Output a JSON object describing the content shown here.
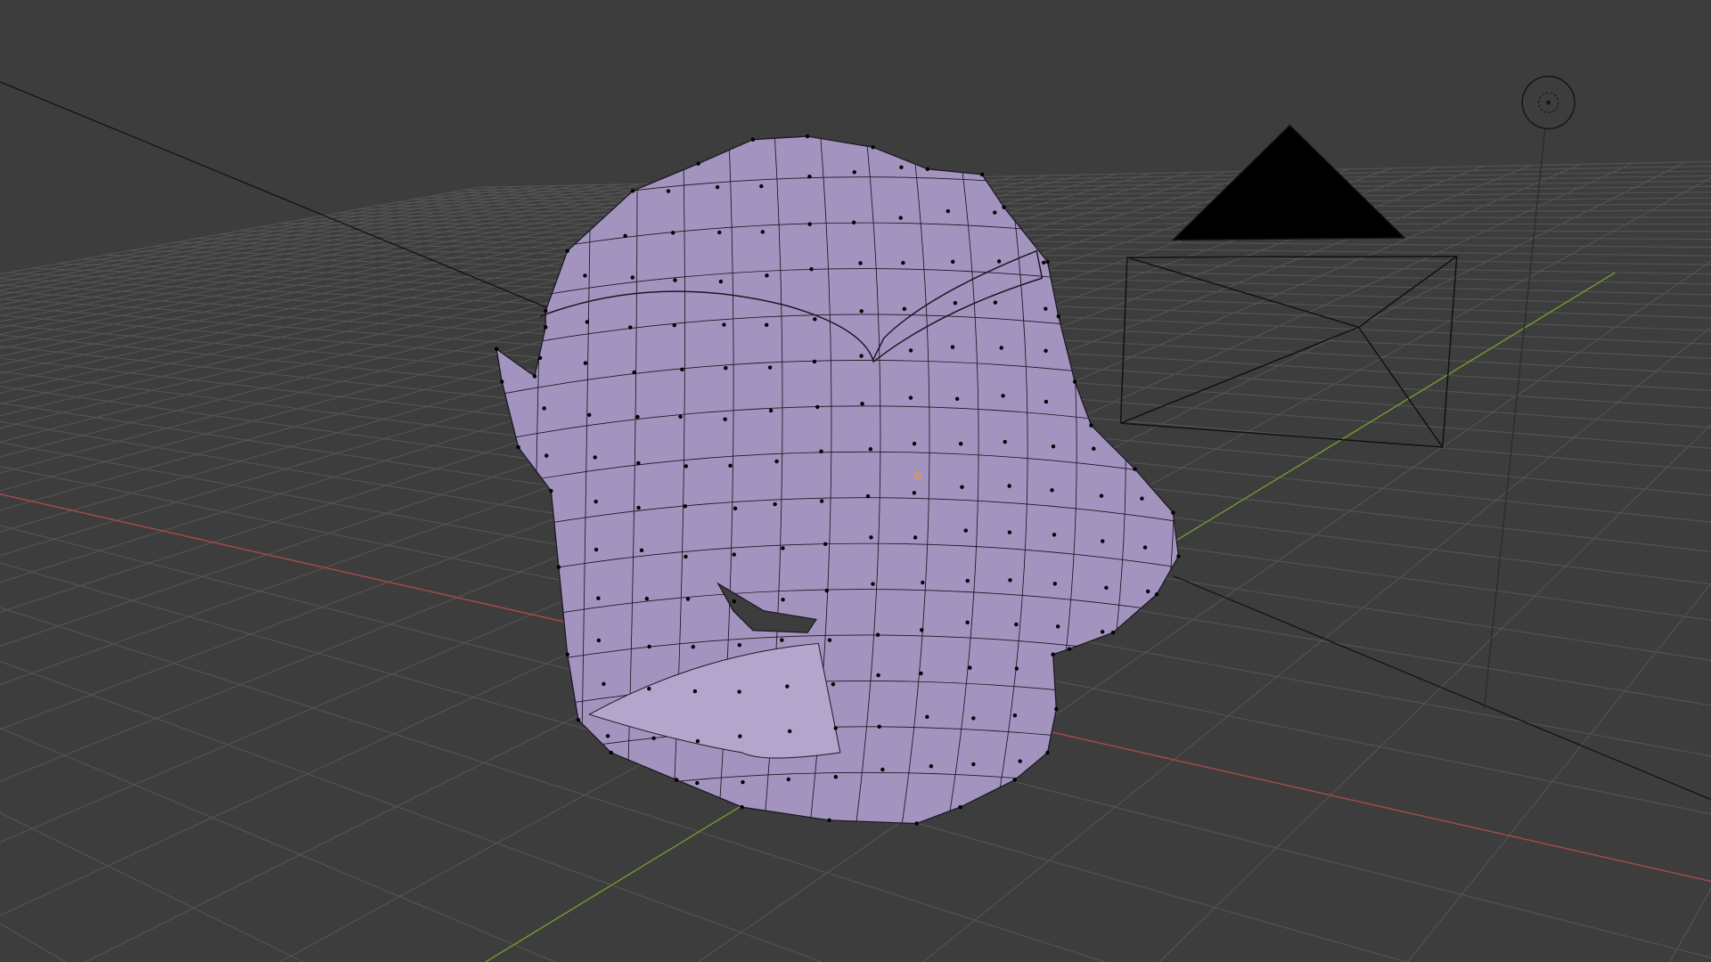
{
  "scene": {
    "background_color": "#3d3d3d",
    "grid_color": "#545454",
    "x_axis_color": "#a44a4a",
    "y_axis_color": "#6e9a2e",
    "mesh_fill_color": "#a394bf",
    "mesh_wire_color": "#1a1620",
    "origin_color": "#e8a020",
    "object_wire_color": "#111111"
  }
}
